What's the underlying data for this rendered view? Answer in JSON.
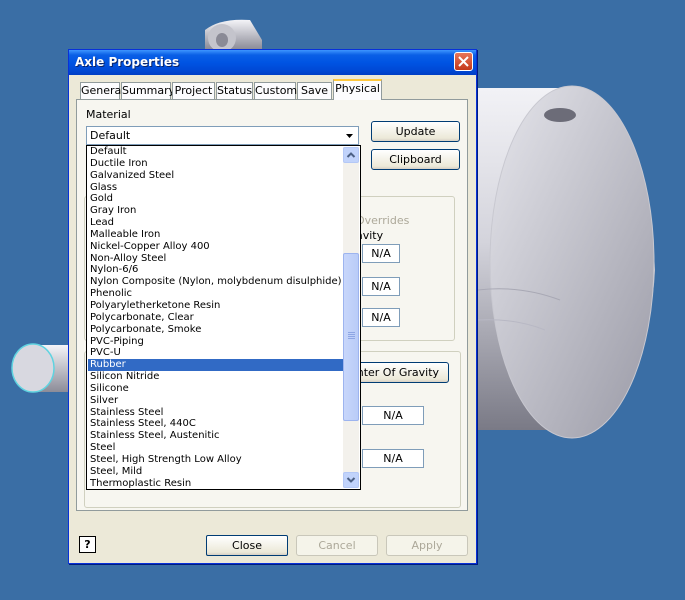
{
  "window": {
    "title": "Axle Properties"
  },
  "tabs": [
    "General",
    "Summary",
    "Project",
    "Status",
    "Custom",
    "Save",
    "Physical"
  ],
  "active_tab": "Physical",
  "material": {
    "label": "Material",
    "selected": "Default",
    "options": [
      "Default",
      "Ductile Iron",
      "Galvanized Steel",
      "Glass",
      "Gold",
      "Gray Iron",
      "Lead",
      "Malleable Iron",
      "Nickel-Copper Alloy 400",
      "Non-Alloy Steel",
      "Nylon-6/6",
      "Nylon Composite (Nylon, molybdenum disulphide)",
      "Phenolic",
      "Polyaryletherketone Resin",
      "Polycarbonate, Clear",
      "Polycarbonate, Smoke",
      "PVC-Piping",
      "PVC-U",
      "Rubber",
      "Silicon Nitride",
      "Silicone",
      "Silver",
      "Stainless Steel",
      "Stainless Steel, 440C",
      "Stainless Steel, Austenitic",
      "Steel",
      "Steel, High Strength Low Alloy",
      "Steel, Mild",
      "Thermoplastic Resin"
    ],
    "highlighted": "Rubber"
  },
  "buttons": {
    "update": "Update",
    "clipboard": "Clipboard",
    "center_of_gravity": "enter Of Gravity",
    "close": "Close",
    "cancel": "Cancel",
    "apply": "Apply"
  },
  "overrides": {
    "label": "Overrides",
    "gravity_label": "avity"
  },
  "values": {
    "na": "N/A"
  },
  "help": {
    "glyph": "?"
  }
}
